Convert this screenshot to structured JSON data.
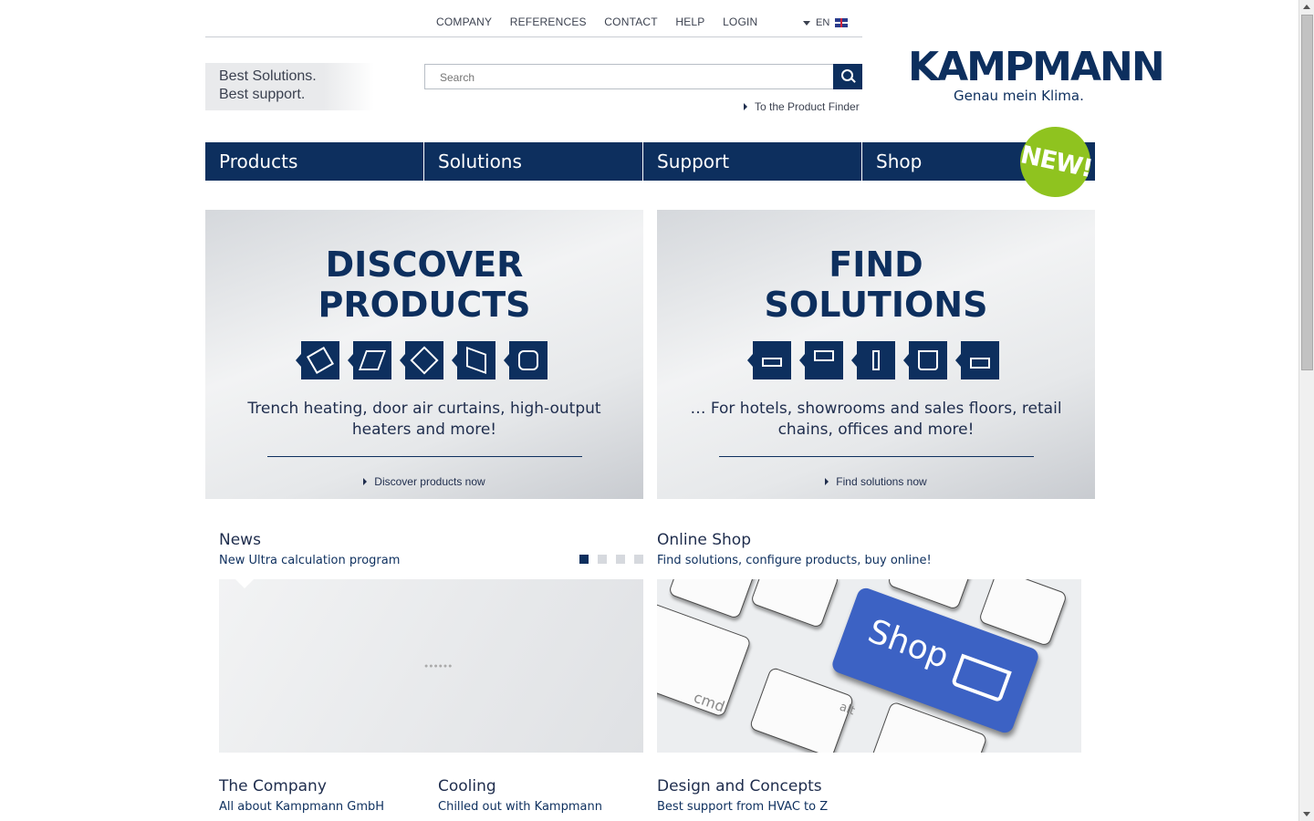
{
  "topnav": {
    "links": [
      "COMPANY",
      "REFERENCES",
      "CONTACT",
      "HELP",
      "LOGIN"
    ],
    "language": "EN"
  },
  "header": {
    "tagline_line1": "Best Solutions.",
    "tagline_line2": "Best support.",
    "search_placeholder": "Search",
    "product_finder": "To the Product Finder",
    "logo_word": "KAMPMANN",
    "logo_claim": "Genau mein Klima."
  },
  "mainnav": {
    "items": [
      "Products",
      "Solutions",
      "Support",
      "Shop"
    ],
    "new_badge": "NEW!"
  },
  "teasers": {
    "products": {
      "headline1": "DISCOVER",
      "headline2": "PRODUCTS",
      "text": "Trench heating, door air curtains, high-output heaters and more!",
      "cta": "Discover products now"
    },
    "solutions": {
      "headline1": "FIND",
      "headline2": "SOLUTIONS",
      "text": "… For hotels, showrooms and sales floors, retail chains, offices and more!",
      "cta": "Find solutions now"
    }
  },
  "news": {
    "title": "News",
    "subtitle": "New Ultra calculation program"
  },
  "shop": {
    "title": "Online Shop",
    "subtitle": "Find solutions, configure products, buy online!",
    "key_label": "Shop",
    "key_cmd": "cmd",
    "key_alt": "alt"
  },
  "bottom": [
    {
      "title": "The Company",
      "subtitle": "All about Kampmann GmbH"
    },
    {
      "title": "Cooling",
      "subtitle": "Chilled out with Kampmann"
    },
    {
      "title": "Design and Concepts",
      "subtitle": "Best support from HVAC to Z"
    }
  ],
  "colors": {
    "brand_navy": "#0d2f5e",
    "badge_green": "#8fc31f",
    "shop_key_blue": "#3c62c4"
  }
}
